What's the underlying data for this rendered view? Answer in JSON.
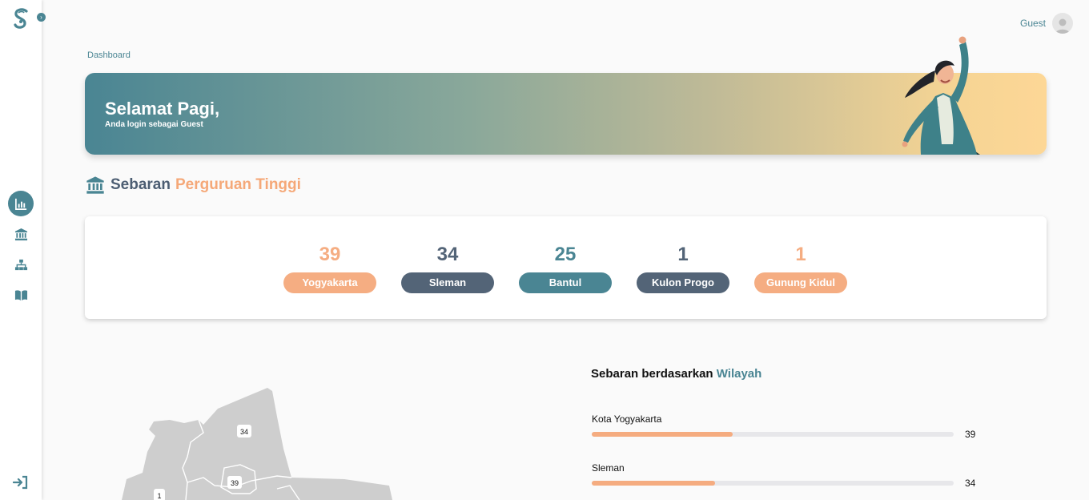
{
  "header": {
    "user": "Guest"
  },
  "breadcrumb": "Dashboard",
  "banner": {
    "title": "Selamat Pagi,",
    "subtitle": "Anda login sebagai Guest"
  },
  "section": {
    "title_main": "Sebaran",
    "title_accent": "Perguruan Tinggi"
  },
  "stats": [
    {
      "value": "39",
      "label": "Yogyakarta",
      "color": "#f5ad82"
    },
    {
      "value": "34",
      "label": "Sleman",
      "color": "#536477"
    },
    {
      "value": "25",
      "label": "Bantul",
      "color": "#4a8593"
    },
    {
      "value": "1",
      "label": "Kulon Progo",
      "color": "#536477"
    },
    {
      "value": "1",
      "label": "Gunung Kidul",
      "color": "#f5ad82"
    }
  ],
  "map": {
    "labels": [
      "34",
      "39",
      "1"
    ]
  },
  "regions": {
    "title_main": "Sebaran berdasarkan",
    "title_accent": "Wilayah",
    "items": [
      {
        "name": "Kota Yogyakarta",
        "value": "39",
        "fraction": 0.39
      },
      {
        "name": "Sleman",
        "value": "34",
        "fraction": 0.34
      }
    ]
  },
  "colors": {
    "primary": "#4a8593",
    "accent": "#f5ad82",
    "slate": "#536477"
  },
  "icons": {
    "logo": "s-logo",
    "expand": "chevron-right-icon",
    "nav": [
      "chart-icon",
      "university-icon",
      "sitemap-icon",
      "book-icon"
    ],
    "logout": "sign-in-icon"
  }
}
